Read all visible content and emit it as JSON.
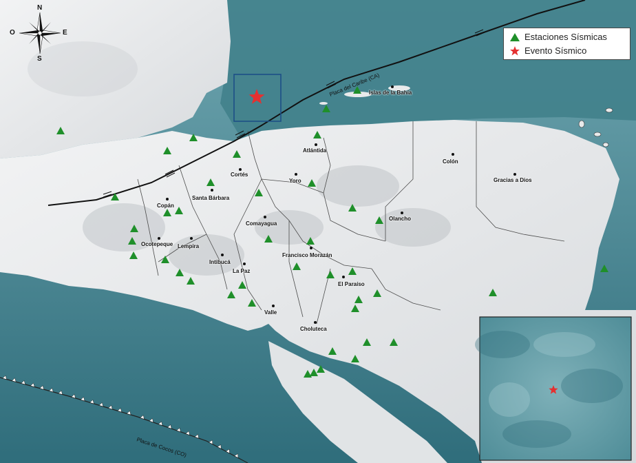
{
  "compass": {
    "n": "N",
    "s": "S",
    "e": "E",
    "w": "O"
  },
  "legend": {
    "stations_label": "Estaciones Sísmicas",
    "event_label": "Evento Sísmico",
    "station_color": "#1f8f2a",
    "event_color": "#e53030"
  },
  "plates": {
    "caribbean": "Placa del Caribe (CA)",
    "cocos": "Placa de Cocos (CO)"
  },
  "places": [
    "Islas de la Bahía",
    "Atlántida",
    "Colón",
    "Cortés",
    "Yoro",
    "Gracias a Dios",
    "Santa Bárbara",
    "Copán",
    "Olancho",
    "Comayagua",
    "Ocotepeque",
    "Lempira",
    "Francisco Morazán",
    "Intibucá",
    "La Paz",
    "El Paraíso",
    "Valle",
    "Choluteca"
  ],
  "colors": {
    "sea": "#3f7f8a",
    "land": "#e8eaeb",
    "land_shade": "#c9cdd0",
    "border": "#4a4a4a",
    "fault": "#111111"
  },
  "icons": [
    "compass-rose-icon",
    "station-triangle-icon",
    "event-star-icon"
  ]
}
